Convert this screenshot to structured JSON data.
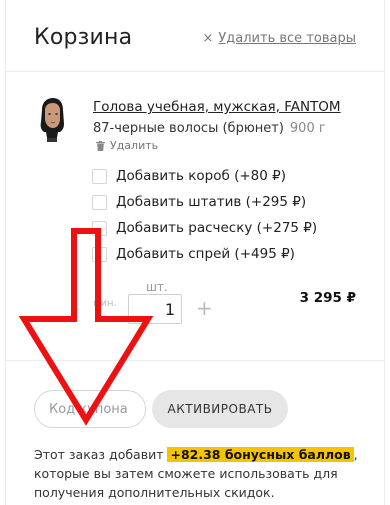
{
  "header": {
    "title": "Корзина",
    "clear_all_icon": "×",
    "clear_all_label": "Удалить все товары"
  },
  "product": {
    "image_icon": "mannequin-head-icon",
    "name": "Голова учебная, мужская, FANTOM",
    "variant": "87-черные волосы (брюнет)",
    "weight": "900 г",
    "remove_label": "Удалить"
  },
  "addons": [
    {
      "label": "Добавить короб (+80 ₽)",
      "checked": false
    },
    {
      "label": "Добавить штатив (+295 ₽)",
      "checked": false
    },
    {
      "label": "Добавить расческу (+275 ₽)",
      "checked": false
    },
    {
      "label": "Добавить спрей (+495 ₽)",
      "checked": false
    }
  ],
  "quantity": {
    "unit": "шт.",
    "min_label": "мин.",
    "value": "1",
    "plus": "+"
  },
  "price": "3 295 ₽",
  "coupon": {
    "placeholder": "Код купона",
    "button_label": "АКТИВИРОВАТЬ"
  },
  "bonus": {
    "before": "Этот заказ добавит ",
    "highlight": "+82.38 бонусных баллов",
    "after": ", которые вы затем сможете использовать для получения дополнительных скидок."
  },
  "annotation": {
    "arrow_color": "#ee1111"
  }
}
